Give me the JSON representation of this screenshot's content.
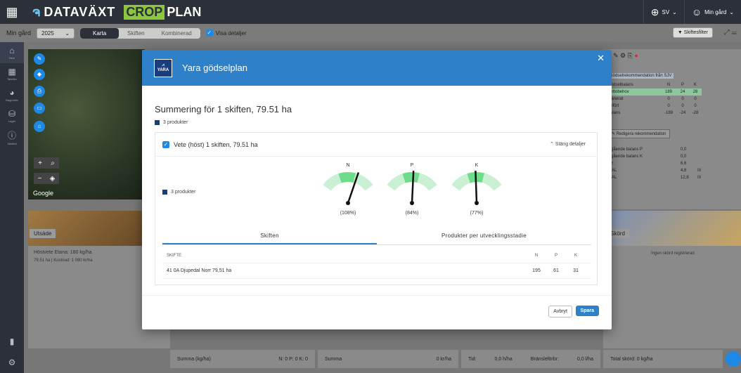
{
  "topbar": {
    "brand": "DATAVÄXT",
    "product_crop": "CROP",
    "product_plan": "PLAN",
    "language": "SV",
    "user": "Min gård"
  },
  "subbar": {
    "farm": "Min gård",
    "year": "2025",
    "tabs": [
      "Karta",
      "Skiften",
      "Kombinerad"
    ],
    "active_tab": "Karta",
    "show_details": "Visa detaljer",
    "filter": "Skiftesfilter"
  },
  "nav": {
    "items": [
      "Hem",
      "Tabeller",
      "Rapporter",
      "Lager",
      "Växtlöd"
    ]
  },
  "map": {
    "attribution": "Google"
  },
  "cards": {
    "seed_tag": "Utsäde",
    "seed_line1": "Höstvete Etana: 180 kg/ha",
    "seed_line2": "79.51 ha | Kostnad: 1 080 kr/ha",
    "harvest_tag": "Skörd",
    "harvest_none": "Ingen skörd registrerad"
  },
  "right_panel": {
    "source": "Gödselrekommendation från SJV",
    "header": [
      "Gödselbalans",
      "N",
      "P",
      "K"
    ],
    "rows": [
      [
        "Nettobehov",
        "189",
        "24",
        "28"
      ],
      [
        "Planerat",
        "0",
        "0",
        "0"
      ],
      [
        "Tillfört",
        "0",
        "0",
        "0"
      ],
      [
        "Balans",
        "-189",
        "-24",
        "-28"
      ]
    ],
    "edit": "Redigera rekommendation",
    "extra": [
      [
        "Ingående balans P",
        "0,0",
        ""
      ],
      [
        "Ingående balans K",
        "0,0",
        ""
      ],
      [
        "pH",
        "6,6",
        ""
      ],
      [
        "P-AL",
        "4,8",
        "III"
      ],
      [
        "K-AL",
        "12,8",
        "III"
      ]
    ]
  },
  "footer": {
    "sum_label": "Summa (kg/ha)",
    "sum_values": "N: 0  P: 0  K: 0",
    "sum2_label": "Summa",
    "sum2_value": "0 kr/ha",
    "time_label": "Tid:",
    "time_value": "0,0 h/ha",
    "fuel_label": "Bränsleförbr:",
    "fuel_value": "0,0 l/ha",
    "harvest_total": "Total skörd: 0 kg/ha"
  },
  "modal": {
    "logo_text": "YARA",
    "title": "Yara gödselplan",
    "summary": "Summering för 1 skiften, 79.51 ha",
    "products": "3 produkter",
    "crop_header": "Vete (höst) 1 skiften, 79.51 ha",
    "toggle": "Stäng detaljer",
    "gauges": [
      {
        "nutrient": "N",
        "percent_label": "(108%)",
        "fraction": 1.08
      },
      {
        "nutrient": "P",
        "percent_label": "(84%)",
        "fraction": 0.84
      },
      {
        "nutrient": "K",
        "percent_label": "(77%)",
        "fraction": 0.77
      }
    ],
    "gauge_products": "3 produkter",
    "tabs": [
      "Skiften",
      "Produkter per utvecklingsstadie"
    ],
    "table": {
      "headers": [
        "SKIFTE",
        "N",
        "P",
        "K"
      ],
      "rows": [
        [
          "41 0A Djupedal Norr 79,51 ha",
          "195",
          "61",
          "31"
        ]
      ]
    },
    "cancel": "Avbryt",
    "save": "Spara"
  },
  "colors": {
    "header_blue": "#2e81c8",
    "gauge_good": "#6fdc8c",
    "gauge_light": "#c9f0d3"
  }
}
